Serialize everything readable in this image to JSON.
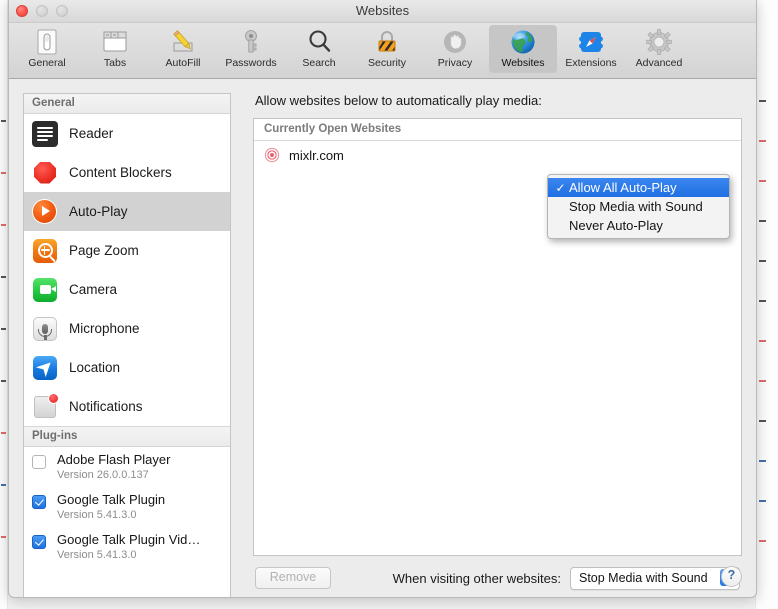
{
  "window": {
    "title": "Websites",
    "traffic_lights": [
      "close",
      "minimize",
      "zoom"
    ]
  },
  "toolbar": {
    "items": [
      {
        "label": "General",
        "icon": "general-icon",
        "selected": false
      },
      {
        "label": "Tabs",
        "icon": "tabs-icon",
        "selected": false
      },
      {
        "label": "AutoFill",
        "icon": "autofill-icon",
        "selected": false
      },
      {
        "label": "Passwords",
        "icon": "passwords-icon",
        "selected": false
      },
      {
        "label": "Search",
        "icon": "search-icon",
        "selected": false
      },
      {
        "label": "Security",
        "icon": "security-icon",
        "selected": false
      },
      {
        "label": "Privacy",
        "icon": "privacy-icon",
        "selected": false
      },
      {
        "label": "Websites",
        "icon": "websites-icon",
        "selected": true
      },
      {
        "label": "Extensions",
        "icon": "extensions-icon",
        "selected": false
      },
      {
        "label": "Advanced",
        "icon": "advanced-icon",
        "selected": false
      }
    ]
  },
  "sidebar": {
    "general_header": "General",
    "general_items": [
      {
        "label": "Reader",
        "icon": "reader-icon",
        "selected": false
      },
      {
        "label": "Content Blockers",
        "icon": "content-blockers-icon",
        "selected": false
      },
      {
        "label": "Auto-Play",
        "icon": "auto-play-icon",
        "selected": true
      },
      {
        "label": "Page Zoom",
        "icon": "page-zoom-icon",
        "selected": false
      },
      {
        "label": "Camera",
        "icon": "camera-icon",
        "selected": false
      },
      {
        "label": "Microphone",
        "icon": "microphone-icon",
        "selected": false
      },
      {
        "label": "Location",
        "icon": "location-icon",
        "selected": false
      },
      {
        "label": "Notifications",
        "icon": "notifications-icon",
        "selected": false
      }
    ],
    "plugins_header": "Plug-ins",
    "plugin_items": [
      {
        "name": "Adobe Flash Player",
        "version": "Version 26.0.0.137",
        "checked": false
      },
      {
        "name": "Google Talk Plugin",
        "version": "Version 5.41.3.0",
        "checked": true
      },
      {
        "name": "Google Talk Plugin Vid…",
        "version": "Version 5.41.3.0",
        "checked": true
      }
    ]
  },
  "main": {
    "caption": "Allow websites below to automatically play media:",
    "table_header": "Currently Open Websites",
    "rows": [
      {
        "site": "mixlr.com",
        "favicon": "mixlr-favicon"
      }
    ],
    "popup_menu": {
      "items": [
        {
          "label": "Allow All Auto-Play",
          "checked": true,
          "highlighted": true
        },
        {
          "label": "Stop Media with Sound",
          "checked": false,
          "highlighted": false
        },
        {
          "label": "Never Auto-Play",
          "checked": false,
          "highlighted": false
        }
      ],
      "check_glyph": "✓",
      "highlight_color": "#1f6fe2"
    }
  },
  "footer": {
    "remove_label": "Remove",
    "other_websites_label": "When visiting other websites:",
    "other_websites_value": "Stop Media with Sound",
    "help_label": "?"
  },
  "background_marks": {
    "left": [
      "dark",
      "red",
      "red",
      "dark",
      "dark",
      "dark",
      "red",
      "blue",
      "red"
    ],
    "right": [
      "dark",
      "red",
      "red",
      "dark",
      "dark",
      "dark",
      "red",
      "red",
      "dark",
      "blue",
      "blue",
      "red"
    ]
  }
}
